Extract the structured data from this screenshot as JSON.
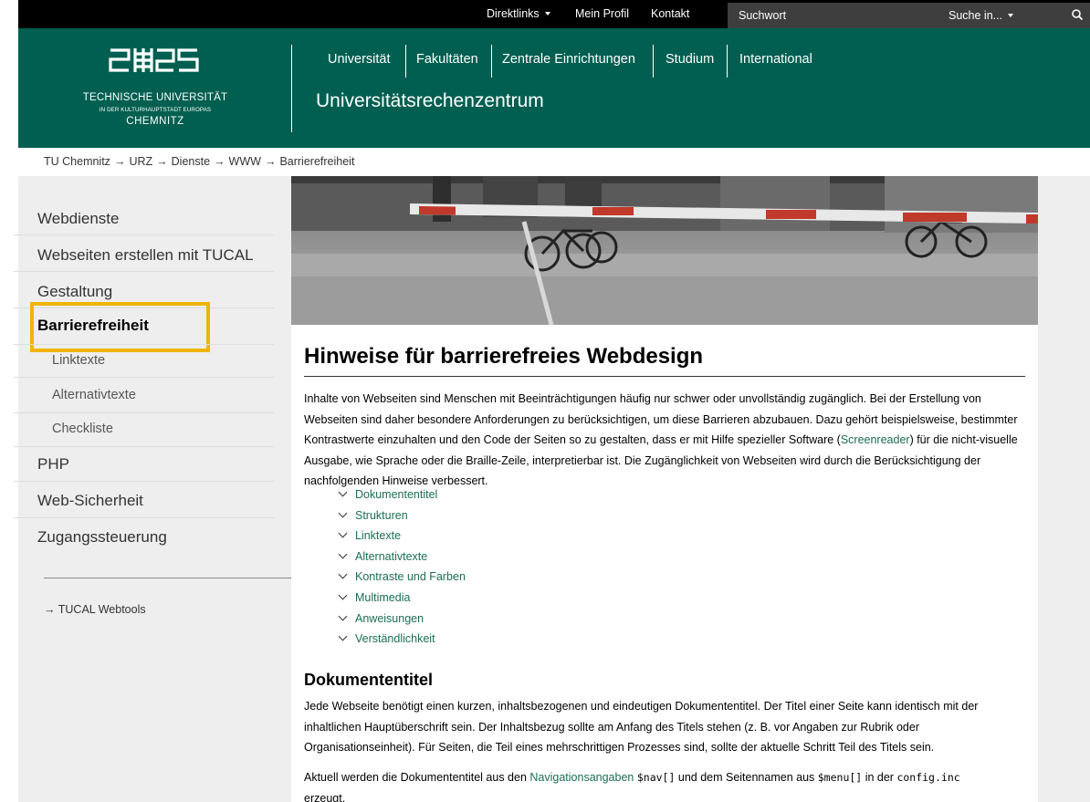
{
  "topbar": {
    "direktlinks": "Direktlinks",
    "mein_profil": "Mein Profil",
    "kontakt": "Kontakt",
    "search_placeholder": "Suchwort",
    "suche_in": "Suche in..."
  },
  "logo": {
    "line1": "TECHNISCHE UNIVERSITÄT",
    "line2": "IN DER KULTURHAUPTSTADT EUROPAS",
    "line3": "CHEMNITZ"
  },
  "header": {
    "nav": [
      "Universität",
      "Fakultäten",
      "Zentrale Einrichtungen",
      "Studium",
      "International"
    ],
    "site_title": "Universitätsrechenzentrum"
  },
  "breadcrumb": [
    "TU Chemnitz",
    "URZ",
    "Dienste",
    "WWW",
    "Barrierefreiheit"
  ],
  "sidebar": {
    "items": [
      "Webdienste",
      "Webseiten erstellen mit TUCAL",
      "Gestaltung"
    ],
    "active": "Barrierefreiheit",
    "subitems": [
      "Linktexte",
      "Alternativtexte",
      "Checkliste"
    ],
    "items_after": [
      "PHP",
      "Web-Sicherheit",
      "Zugangssteuerung"
    ],
    "tools_link": "TUCAL Webtools"
  },
  "main": {
    "title": "Hinweise für barrierefreies Webdesign",
    "intro_before": "Inhalte von Webseiten sind Menschen mit Beeinträchtigungen häufig nur schwer oder unvollständig zugänglich. Bei der Erstellung von Webseiten sind daher besondere Anforderungen zu berücksichtigen, um diese Barrieren abzubauen. Dazu gehört beispielsweise, bestimmter Kontrastwerte einzuhalten und den Code der Seiten so zu gestalten, dass er mit Hilfe spezieller Software (",
    "intro_link": "Screenreader",
    "intro_after": ") für die nicht-visuelle Ausgabe, wie Sprache oder die Braille-Zeile, interpretierbar ist. Die Zugänglichkeit von Webseiten wird durch die Berücksichtigung der nachfolgenden Hinweise verbessert.",
    "toc": [
      "Dokumententitel",
      "Strukturen",
      "Linktexte",
      "Alternativtexte",
      "Kontraste und Farben",
      "Multimedia",
      "Anweisungen",
      "Verständlichkeit"
    ],
    "section_title": "Dokumententitel",
    "section_text": "Jede Webseite benötigt einen kurzen, inhaltsbezogenen und eindeutigen Dokumententitel. Der Titel einer Seite kann identisch mit der inhaltlichen Hauptüberschrift sein. Der Inhaltsbezug sollte am Anfang des Titels stehen (z. B. vor Angaben zur Rubrik oder Organisationseinheit). Für Seiten, die Teil eines mehrschrittigen Prozesses sind, sollte der aktuelle Schritt Teil des Titels sein.",
    "p2_a": "Aktuell werden die Dokumententitel aus den ",
    "p2_link": "Navigationsangaben",
    "p2_code1": "$nav[]",
    "p2_b": " und dem Seitennamen aus ",
    "p2_code2": "$menu[]",
    "p2_c": " in der ",
    "p2_code3": "config.inc",
    "p2_d": "erzeugt."
  },
  "colors": {
    "header_green": "#005f50",
    "link_green": "#1a6e55",
    "focus_yellow": "#f0b400"
  }
}
